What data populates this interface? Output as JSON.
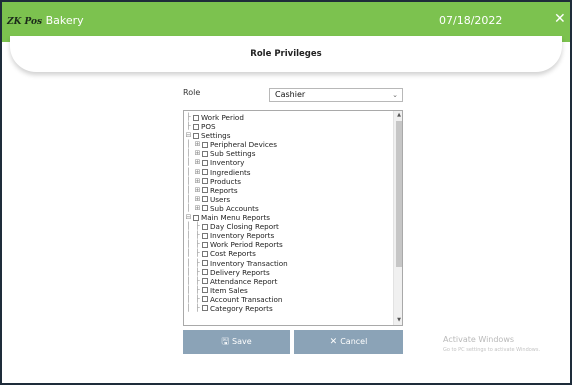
{
  "window": {
    "brand": "ZK Pos",
    "title": "Bakery",
    "date": "07/18/2022",
    "close_icon": "close-icon",
    "accent_color": "#7cc24f"
  },
  "page": {
    "title": "Role Privileges"
  },
  "role": {
    "label": "Role",
    "selected": "Cashier"
  },
  "tree": [
    {
      "label": "Work Period",
      "depth": 0,
      "expander": "none"
    },
    {
      "label": "POS",
      "depth": 0,
      "expander": "none"
    },
    {
      "label": "Settings",
      "depth": 0,
      "expander": "minus"
    },
    {
      "label": "Peripheral Devices",
      "depth": 1,
      "expander": "plus"
    },
    {
      "label": "Sub Settings",
      "depth": 1,
      "expander": "plus"
    },
    {
      "label": "Inventory",
      "depth": 1,
      "expander": "plus"
    },
    {
      "label": "Ingredients",
      "depth": 1,
      "expander": "plus"
    },
    {
      "label": "Products",
      "depth": 1,
      "expander": "plus"
    },
    {
      "label": "Reports",
      "depth": 1,
      "expander": "plus"
    },
    {
      "label": "Users",
      "depth": 1,
      "expander": "plus"
    },
    {
      "label": "Sub Accounts",
      "depth": 1,
      "expander": "plus"
    },
    {
      "label": "Main Menu Reports",
      "depth": 0,
      "expander": "minus"
    },
    {
      "label": "Day Closing Report",
      "depth": 1,
      "expander": "none"
    },
    {
      "label": "Inventory Reports",
      "depth": 1,
      "expander": "none"
    },
    {
      "label": "Work Period Reports",
      "depth": 1,
      "expander": "none"
    },
    {
      "label": "Cost Reports",
      "depth": 1,
      "expander": "none"
    },
    {
      "label": "Inventory Transaction",
      "depth": 1,
      "expander": "none"
    },
    {
      "label": "Delivery Reports",
      "depth": 1,
      "expander": "none"
    },
    {
      "label": "Attendance Report",
      "depth": 1,
      "expander": "none"
    },
    {
      "label": "Item Sales",
      "depth": 1,
      "expander": "none"
    },
    {
      "label": "Account Transaction",
      "depth": 1,
      "expander": "none"
    },
    {
      "label": "Category Reports",
      "depth": 1,
      "expander": "none"
    }
  ],
  "buttons": {
    "save_label": "Save",
    "save_icon": "save-icon",
    "cancel_label": "Cancel",
    "cancel_icon": "cancel-x-icon"
  },
  "watermark": {
    "title": "Activate Windows",
    "subtitle": "Go to PC settings to activate Windows."
  }
}
